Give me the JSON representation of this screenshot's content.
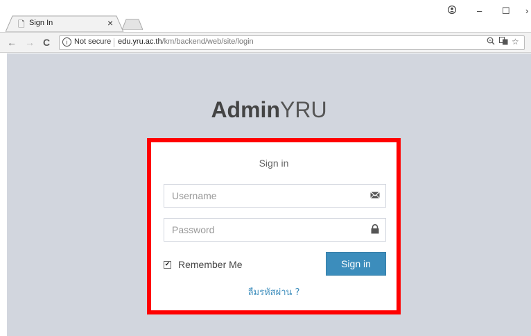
{
  "browser": {
    "tab_title": "Sign In",
    "tab_close": "×",
    "window_controls": {
      "profile": "👤",
      "minimize": "–",
      "maximize": "☐",
      "close": "×"
    },
    "nav": {
      "back": "←",
      "forward": "→",
      "reload": "C"
    },
    "address_bar": {
      "security_label": "Not secure",
      "url_host": "edu.yru.ac.th",
      "url_path": "/km/backend/web/site/login"
    }
  },
  "brand": {
    "bold": "Admin",
    "light": "YRU"
  },
  "login": {
    "title": "Sign in",
    "username_placeholder": "Username",
    "username_value": "",
    "password_placeholder": "Password",
    "password_value": "",
    "remember_label": "Remember Me",
    "remember_checked": true,
    "signin_label": "Sign in",
    "forgot_label": "ลืมรหัสผ่าน ?"
  },
  "colors": {
    "page_bg": "#d2d6de",
    "primary": "#3c8dbc",
    "highlight": "#ff0000"
  }
}
